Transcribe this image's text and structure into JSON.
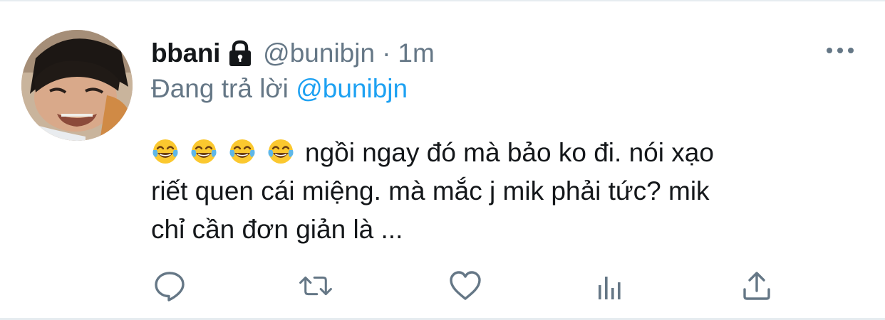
{
  "tweet": {
    "display_name": "bbani",
    "handle": "@bunibjn",
    "separator": "·",
    "time": "1m",
    "replying_prefix": "Đang trả lời",
    "replying_to": "@bunibjn",
    "emoji_count": 4,
    "emoji_name": "face-with-tears-of-joy",
    "text_line1": "ngồi ngay đó mà bảo ko đi.  nói xạo",
    "text_line2": "riết quen cái miệng. mà mắc j mik phải tức? mik",
    "text_line3": "chỉ cần đơn giản là ..."
  },
  "icons": {
    "lock": "lock-icon",
    "more": "more-horizontal-icon",
    "reply": "reply-bubble-icon",
    "retweet": "retweet-icon",
    "like": "heart-icon",
    "analytics": "analytics-bars-icon",
    "share": "share-upload-icon"
  },
  "colors": {
    "name": "#14171a",
    "secondary": "#657786",
    "accent_blue": "#1da1f2",
    "divider": "#e6ecf0"
  }
}
